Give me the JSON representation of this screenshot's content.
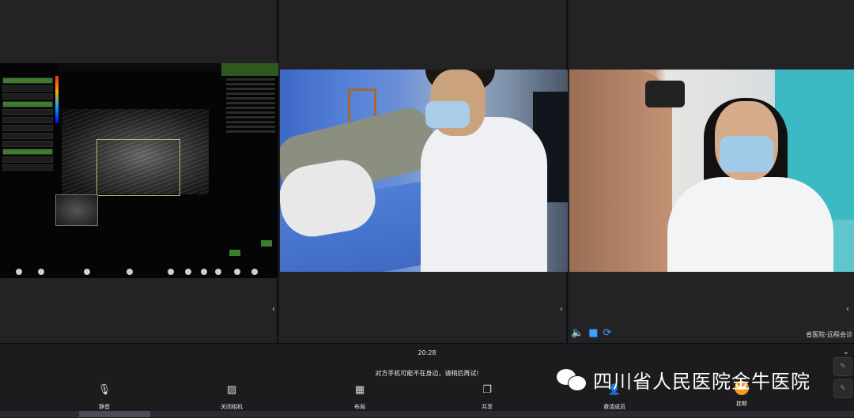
{
  "call": {
    "clock": "20:28",
    "notice": "对方手机可能不在身边，请稍后再试!"
  },
  "panels": {
    "right_caption": "省医院-远程会诊"
  },
  "toolbar": {
    "mute_label": "静音",
    "camera_off_label": "关闭相机",
    "layout_label": "布局",
    "share_label": "共享",
    "invite_label": "邀请成员",
    "hangup_label": "挂断"
  },
  "watermark": {
    "text": "四川省人民医院金牛医院"
  },
  "colors": {
    "accent_blue": "#3da0ff",
    "hangup_orange": "#f49a1e",
    "ultrasound_green": "#3d7c2c"
  },
  "icons": {
    "mute": "mic-off-icon",
    "camera": "camera-off-icon",
    "layout": "layout-icon",
    "share": "share-icon",
    "invite": "add-user-icon",
    "hangup": "hangup-icon"
  }
}
